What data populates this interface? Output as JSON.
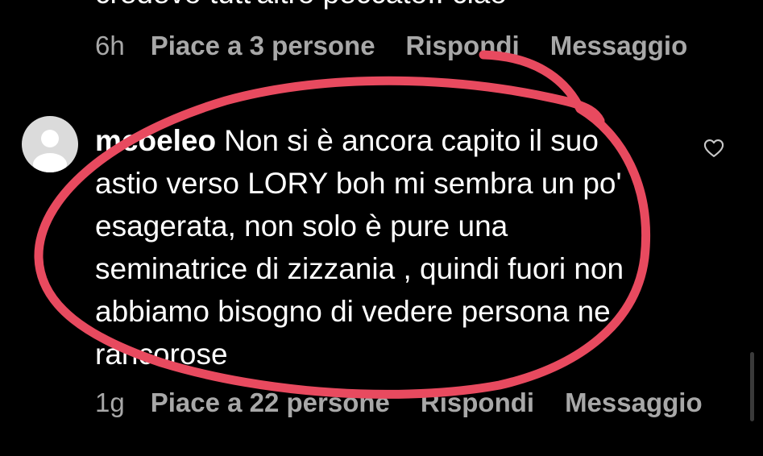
{
  "previous_comment": {
    "text_fragment": "credevo tutt'altro peccato.. ciao",
    "age": "6h",
    "likes": "Piace a 3 persone",
    "reply": "Rispondi",
    "message": "Messaggio"
  },
  "comment": {
    "username": "mcoeleo",
    "text": "Non si è ancora capito il suo astio verso LORY boh mi sembra un po' esagerata, non solo è pure una seminatrice di zizzania , quindi fuori non abbiamo bisogno di vedere persona ne rancorose",
    "age": "1g",
    "likes": "Piace a 22 persone",
    "reply": "Rispondi",
    "message": "Messaggio"
  },
  "icons": {
    "avatar": "default-avatar-icon",
    "like": "heart-icon"
  },
  "colors": {
    "background": "#000000",
    "text": "#ffffff",
    "meta": "#a8a8a8",
    "annotation": "#e84a5f"
  }
}
